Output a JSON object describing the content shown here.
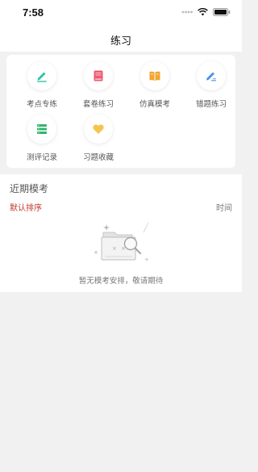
{
  "status_bar": {
    "time": "7:58",
    "icons": [
      "signal-icon",
      "wifi-icon",
      "battery-icon"
    ]
  },
  "nav": {
    "title": "练习"
  },
  "menu": [
    {
      "label": "考点专练",
      "icon": "pen-icon",
      "color": "#2ec4a6"
    },
    {
      "label": "套卷练习",
      "icon": "paper-set-icon",
      "color": "#ee5a72"
    },
    {
      "label": "仿真模考",
      "icon": "book-icon",
      "color": "#f2a531"
    },
    {
      "label": "错题练习",
      "icon": "edit-icon",
      "color": "#4b8ef1"
    },
    {
      "label": "测评记录",
      "icon": "list-icon",
      "color": "#30b56e"
    },
    {
      "label": "习题收藏",
      "icon": "heart-icon",
      "color": "#f5c44f"
    }
  ],
  "recent_exams": {
    "title": "近期模考",
    "sort_default": "默认排序",
    "sort_time": "时间",
    "empty_text": "暂无模考安排，敬请期待"
  },
  "colors": {
    "accent_red": "#c0392b",
    "background": "#f1f1f1"
  }
}
